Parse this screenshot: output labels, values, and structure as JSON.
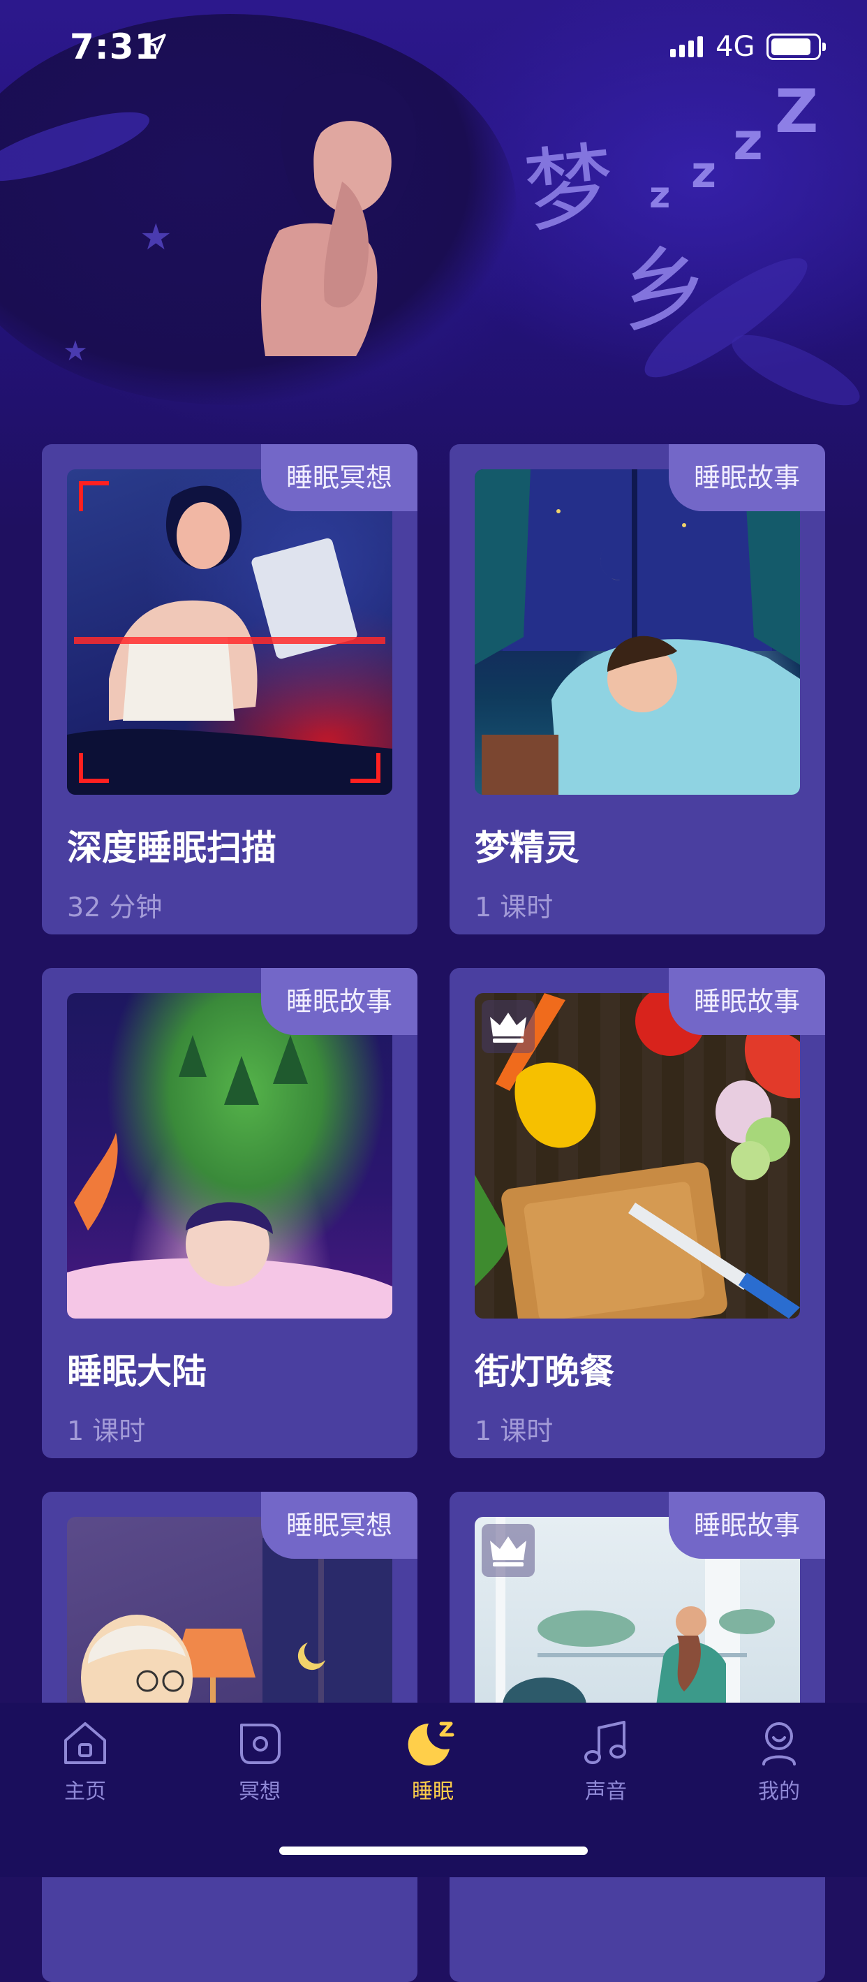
{
  "status_bar": {
    "time": "7:31",
    "network": "4G"
  },
  "hero": {
    "title_chars": [
      "梦",
      "乡"
    ],
    "zzz": [
      "z",
      "z",
      "z",
      "Z"
    ]
  },
  "cards": [
    {
      "tag": "睡眠冥想",
      "title": "深度睡眠扫描",
      "meta": "32 分钟",
      "premium": false
    },
    {
      "tag": "睡眠故事",
      "title": "梦精灵",
      "meta": "1 课时",
      "premium": false
    },
    {
      "tag": "睡眠故事",
      "title": "睡眠大陆",
      "meta": "1 课时",
      "premium": false
    },
    {
      "tag": "睡眠故事",
      "title": "街灯晚餐",
      "meta": "1 课时",
      "premium": true
    },
    {
      "tag": "睡眠冥想",
      "title": "",
      "meta": "",
      "premium": false
    },
    {
      "tag": "睡眠故事",
      "title": "",
      "meta": "",
      "premium": true
    }
  ],
  "tabs": [
    {
      "label": "主页",
      "icon": "home-icon",
      "active": false
    },
    {
      "label": "冥想",
      "icon": "meditation-icon",
      "active": false
    },
    {
      "label": "睡眠",
      "icon": "moon-icon",
      "active": true
    },
    {
      "label": "声音",
      "icon": "music-note-icon",
      "active": false
    },
    {
      "label": "我的",
      "icon": "profile-icon",
      "active": false
    }
  ],
  "colors": {
    "background": "#1f1060",
    "card": "#4a3fa0",
    "tag": "#7367c8",
    "active_tab": "#ffcf4a",
    "inactive_tab": "#8f88d6"
  }
}
